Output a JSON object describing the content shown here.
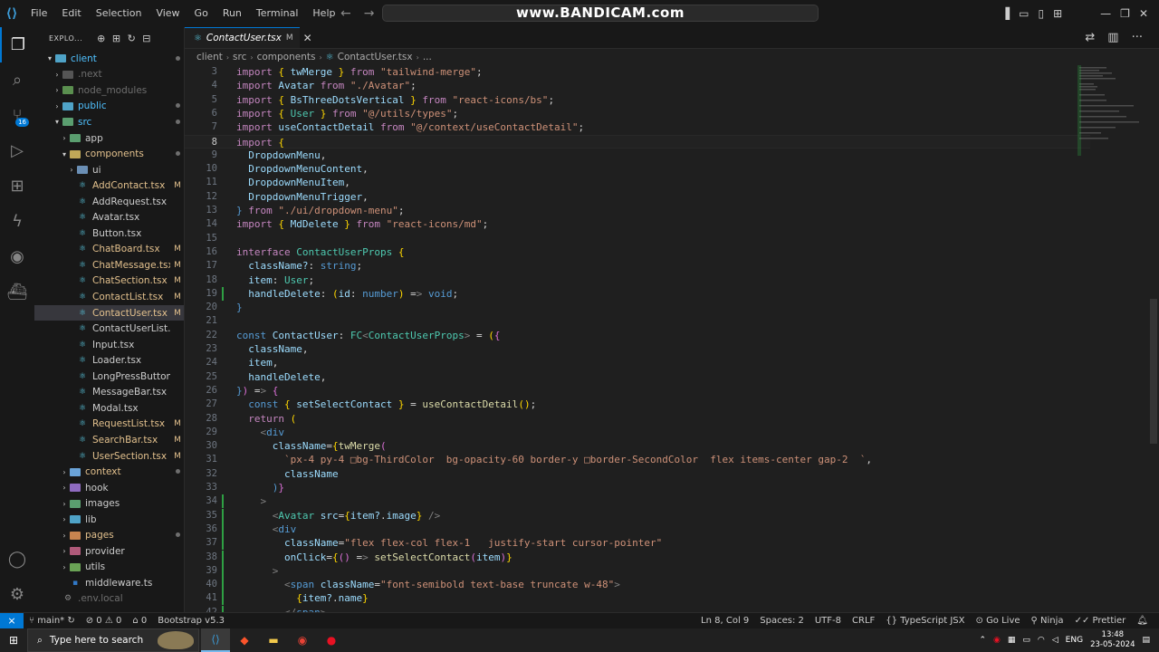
{
  "titlebar": {
    "menus": [
      "File",
      "Edit",
      "Selection",
      "View",
      "Go",
      "Run",
      "Terminal",
      "Help"
    ],
    "watermark": "www.BANDICAM.com"
  },
  "explorer": {
    "title": "EXPLO...",
    "tree": [
      {
        "label": "client",
        "depth": 0,
        "kind": "folder-open",
        "color": "#4fc1ff",
        "status": "dot"
      },
      {
        "label": ".next",
        "depth": 1,
        "kind": "folder",
        "color": "#6e6e6e",
        "status": "",
        "dim": true
      },
      {
        "label": "node_modules",
        "depth": 1,
        "kind": "folder",
        "color": "#6e6e6e",
        "status": "",
        "dim": true
      },
      {
        "label": "public",
        "depth": 1,
        "kind": "folder",
        "color": "#4fc1ff",
        "status": "dot"
      },
      {
        "label": "src",
        "depth": 1,
        "kind": "folder-open",
        "color": "#4fc1ff",
        "status": "dot"
      },
      {
        "label": "app",
        "depth": 2,
        "kind": "folder",
        "color": "#cccccc",
        "status": ""
      },
      {
        "label": "components",
        "depth": 2,
        "kind": "folder-open",
        "color": "#e2c08d",
        "status": "dot"
      },
      {
        "label": "ui",
        "depth": 3,
        "kind": "folder",
        "color": "#cccccc",
        "status": ""
      },
      {
        "label": "AddContact.tsx",
        "depth": 3,
        "kind": "file",
        "color": "#e2c08d",
        "status": "M"
      },
      {
        "label": "AddRequest.tsx",
        "depth": 3,
        "kind": "file",
        "color": "#cccccc",
        "status": ""
      },
      {
        "label": "Avatar.tsx",
        "depth": 3,
        "kind": "file",
        "color": "#cccccc",
        "status": ""
      },
      {
        "label": "Button.tsx",
        "depth": 3,
        "kind": "file",
        "color": "#cccccc",
        "status": ""
      },
      {
        "label": "ChatBoard.tsx",
        "depth": 3,
        "kind": "file",
        "color": "#e2c08d",
        "status": "M"
      },
      {
        "label": "ChatMessage.tsx",
        "depth": 3,
        "kind": "file",
        "color": "#e2c08d",
        "status": "M"
      },
      {
        "label": "ChatSection.tsx",
        "depth": 3,
        "kind": "file",
        "color": "#e2c08d",
        "status": "M"
      },
      {
        "label": "ContactList.tsx",
        "depth": 3,
        "kind": "file",
        "color": "#e2c08d",
        "status": "M"
      },
      {
        "label": "ContactUser.tsx",
        "depth": 3,
        "kind": "file",
        "color": "#e2c08d",
        "status": "M",
        "selected": true
      },
      {
        "label": "ContactUserList.tsx",
        "depth": 3,
        "kind": "file",
        "color": "#cccccc",
        "status": ""
      },
      {
        "label": "Input.tsx",
        "depth": 3,
        "kind": "file",
        "color": "#cccccc",
        "status": ""
      },
      {
        "label": "Loader.tsx",
        "depth": 3,
        "kind": "file",
        "color": "#cccccc",
        "status": ""
      },
      {
        "label": "LongPressButton.tsx",
        "depth": 3,
        "kind": "file",
        "color": "#cccccc",
        "status": ""
      },
      {
        "label": "MessageBar.tsx",
        "depth": 3,
        "kind": "file",
        "color": "#cccccc",
        "status": ""
      },
      {
        "label": "Modal.tsx",
        "depth": 3,
        "kind": "file",
        "color": "#cccccc",
        "status": ""
      },
      {
        "label": "RequestList.tsx",
        "depth": 3,
        "kind": "file",
        "color": "#e2c08d",
        "status": "M"
      },
      {
        "label": "SearchBar.tsx",
        "depth": 3,
        "kind": "file",
        "color": "#e2c08d",
        "status": "M"
      },
      {
        "label": "UserSection.tsx",
        "depth": 3,
        "kind": "file",
        "color": "#e2c08d",
        "status": "M"
      },
      {
        "label": "context",
        "depth": 2,
        "kind": "folder",
        "color": "#e2c08d",
        "status": "dot"
      },
      {
        "label": "hook",
        "depth": 2,
        "kind": "folder",
        "color": "#cccccc",
        "status": ""
      },
      {
        "label": "images",
        "depth": 2,
        "kind": "folder",
        "color": "#cccccc",
        "status": ""
      },
      {
        "label": "lib",
        "depth": 2,
        "kind": "folder",
        "color": "#cccccc",
        "status": ""
      },
      {
        "label": "pages",
        "depth": 2,
        "kind": "folder",
        "color": "#e2c08d",
        "status": "dot"
      },
      {
        "label": "provider",
        "depth": 2,
        "kind": "folder",
        "color": "#cccccc",
        "status": ""
      },
      {
        "label": "utils",
        "depth": 2,
        "kind": "folder",
        "color": "#cccccc",
        "status": ""
      },
      {
        "label": "middleware.ts",
        "depth": 2,
        "kind": "ts",
        "color": "#cccccc",
        "status": ""
      },
      {
        "label": ".env.local",
        "depth": 1,
        "kind": "env",
        "color": "#6e6e6e",
        "status": "",
        "dim": true
      }
    ]
  },
  "editor": {
    "tab_label": "ContactUser.tsx",
    "tab_status": "M",
    "breadcrumb": [
      "client",
      "src",
      "components",
      "ContactUser.tsx",
      "..."
    ],
    "lines": [
      {
        "n": "3",
        "text": "import { twMerge } from \"tailwind-merge\";"
      },
      {
        "n": "4",
        "text": "import Avatar from \"./Avatar\";"
      },
      {
        "n": "5",
        "text": "import { BsThreeDotsVertical } from \"react-icons/bs\";"
      },
      {
        "n": "6",
        "text": "import { User } from \"@/utils/types\";"
      },
      {
        "n": "7",
        "text": "import useContactDetail from \"@/context/useContactDetail\";"
      },
      {
        "n": "8",
        "text": "import {",
        "current": true
      },
      {
        "n": "9",
        "text": "  DropdownMenu,"
      },
      {
        "n": "10",
        "text": "  DropdownMenuContent,"
      },
      {
        "n": "11",
        "text": "  DropdownMenuItem,"
      },
      {
        "n": "12",
        "text": "  DropdownMenuTrigger,"
      },
      {
        "n": "13",
        "text": "} from \"./ui/dropdown-menu\";"
      },
      {
        "n": "14",
        "text": "import { MdDelete } from \"react-icons/md\";"
      },
      {
        "n": "15",
        "text": ""
      },
      {
        "n": "16",
        "text": "interface ContactUserProps {"
      },
      {
        "n": "17",
        "text": "  className?: string;"
      },
      {
        "n": "18",
        "text": "  item: User;"
      },
      {
        "n": "19",
        "text": "  handleDelete: (id: number) => void;",
        "gutter": true
      },
      {
        "n": "20",
        "text": "}"
      },
      {
        "n": "21",
        "text": ""
      },
      {
        "n": "22",
        "text": "const ContactUser: FC<ContactUserProps> = ({"
      },
      {
        "n": "23",
        "text": "  className,"
      },
      {
        "n": "24",
        "text": "  item,"
      },
      {
        "n": "25",
        "text": "  handleDelete,"
      },
      {
        "n": "26",
        "text": "}) => {"
      },
      {
        "n": "27",
        "text": "  const { setSelectContact } = useContactDetail();"
      },
      {
        "n": "28",
        "text": "  return ("
      },
      {
        "n": "29",
        "text": "    <div"
      },
      {
        "n": "30",
        "text": "      className={twMerge("
      },
      {
        "n": "31",
        "text": "        `px-4 py-4 □bg-ThirdColor  bg-opacity-60 border-y □border-SecondColor  flex items-center gap-2  `,"
      },
      {
        "n": "32",
        "text": "        className"
      },
      {
        "n": "33",
        "text": "      )}"
      },
      {
        "n": "34",
        "text": "    >",
        "gutter": true
      },
      {
        "n": "35",
        "text": "      <Avatar src={item?.image} />",
        "gutter": true
      },
      {
        "n": "36",
        "text": "      <div",
        "gutter": true
      },
      {
        "n": "37",
        "text": "        className=\"flex flex-col flex-1   justify-start cursor-pointer\"",
        "gutter": true
      },
      {
        "n": "38",
        "text": "        onClick={() => setSelectContact(item)}",
        "gutter": true
      },
      {
        "n": "39",
        "text": "      >",
        "gutter": true
      },
      {
        "n": "40",
        "text": "        <span className=\"font-semibold text-base truncate w-48\">",
        "gutter": true
      },
      {
        "n": "41",
        "text": "          {item?.name}",
        "gutter": true
      },
      {
        "n": "42",
        "text": "        </span>",
        "gutter": true
      }
    ]
  },
  "statusbar": {
    "branch": "main*",
    "problems": "⊘ 0 ⚠ 0",
    "ports": "⌂ 0",
    "bootstrap": "Bootstrap v5.3",
    "cursor": "Ln 8, Col 9",
    "spaces": "Spaces: 2",
    "encoding": "UTF-8",
    "eol": "CRLF",
    "language": "TypeScript JSX",
    "golive": "Go Live",
    "ninja": "Ninja",
    "prettier": "Prettier"
  },
  "taskbar": {
    "search_placeholder": "Type here to search",
    "lang": "ENG",
    "time": "13:48",
    "date": "23-05-2024"
  }
}
